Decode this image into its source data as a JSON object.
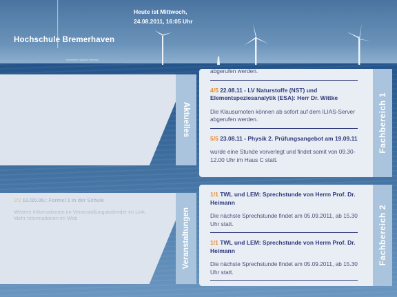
{
  "header": {
    "date_line1": "Heute ist Mittwoch,",
    "date_line2": "24.08.2011, 16:05 Uhr",
    "logo": "Hochschule Bremerhaven",
    "logo_sub": "University of Applied Sciences"
  },
  "left": {
    "aktuelles": {
      "tab_label": "Aktuelles"
    },
    "veranstaltungen": {
      "tab_label": "Veranstaltungen",
      "item_number": "2/3",
      "item_title": "19./20.09.: Formel 1 in der Schule",
      "item_line1": "Weitere Informationen im Veranstaltungskalender im Link.",
      "item_line2": "Mehr Informationen im Web"
    }
  },
  "fb1": {
    "tab_label": "Fachbereich 1",
    "top_text": "abgerufen werden.",
    "items": [
      {
        "number": "4/5",
        "title": "22.08.11 - LV Naturstoffe (NST) und Elementspeziesanalytik (ESA): Herr Dr. Wittke",
        "text": "Die Klausurnoten können ab sofort auf dem ILIAS-Server abgerufen werden."
      },
      {
        "number": "5/5",
        "title": "23.08.11 - Physik 2. Prüfungsangebot am 19.09.11",
        "text": "wurde eine Stunde vorverlegt und findet somit von 09.30-12.00 Uhr im Haus C statt."
      }
    ]
  },
  "fb2": {
    "tab_label": "Fachbereich 2",
    "items": [
      {
        "number": "1/1",
        "title": "TWL und LEM: Sprechstunde von Herrn Prof. Dr. Heimann",
        "text": "Die nächste Sprechstunde findet am 05.09.2011, ab 15.30 Uhr statt."
      },
      {
        "number": "1/1",
        "title": "TWL und LEM: Sprechstunde von Herrn Prof. Dr. Heimann",
        "text": "Die nächste Sprechstunde findet am 05.09.2011, ab 15.30 Uhr statt."
      }
    ]
  }
}
